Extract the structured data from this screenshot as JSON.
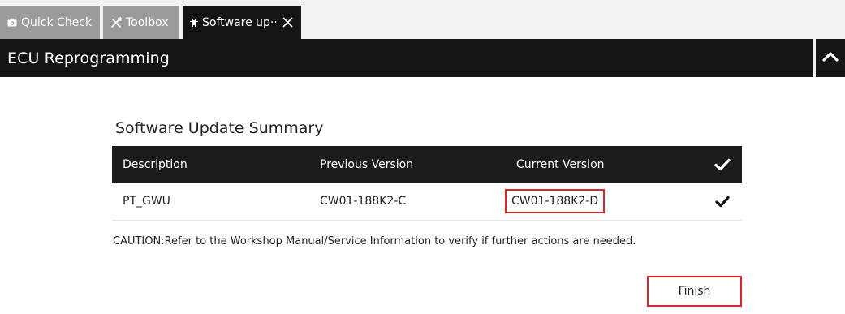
{
  "tabs": [
    {
      "label": "Quick Check",
      "icon": "camera-icon",
      "active": false
    },
    {
      "label": "Toolbox",
      "icon": "tools-icon",
      "active": false
    },
    {
      "label": "Software up··",
      "icon": "chip-icon",
      "active": true
    }
  ],
  "header": {
    "title": "ECU Reprogramming"
  },
  "summary": {
    "title": "Software Update Summary",
    "columns": [
      "Description",
      "Previous Version",
      "Current Version"
    ],
    "rows": [
      {
        "description": "PT_GWU",
        "previous": "CW01-188K2-C",
        "current": "CW01-188K2-D"
      }
    ],
    "caution": "CAUTION:Refer to the Workshop Manual/Service Information to verify if further actions are needed."
  },
  "actions": {
    "finish_label": "Finish"
  },
  "colors": {
    "dark": "#141414",
    "inactive_tab": "#9b9b9b",
    "highlight": "#d9262c"
  }
}
